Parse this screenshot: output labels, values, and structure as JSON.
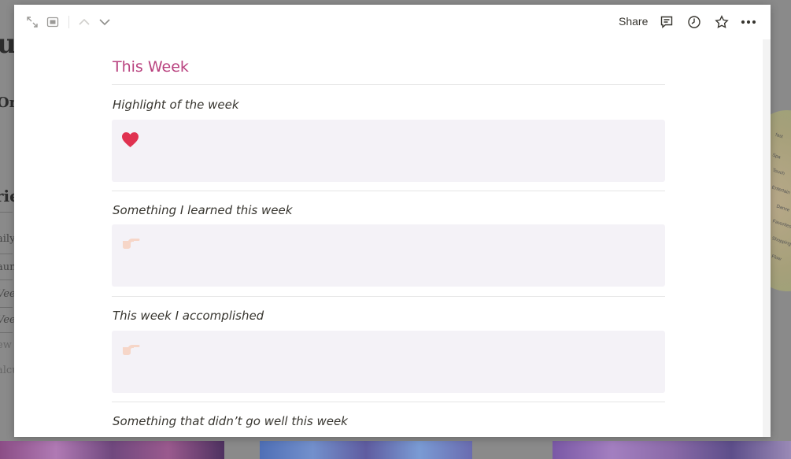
{
  "background_page": {
    "text_fragments": [
      {
        "text": "u",
        "class": "bg-big",
        "top": null
      },
      {
        "text": "On",
        "class": "bg-on",
        "top": null
      },
      {
        "text": "rie",
        "class": "bg-rie",
        "top": null
      }
    ],
    "sidebar_items": [
      "aily",
      "aun",
      "Vee",
      "Vee",
      "ew",
      "alcu"
    ],
    "wheel_labels": [
      "fast",
      "Spa",
      "Touch",
      "Entertain",
      "Dance",
      "Favorites",
      "Shopping",
      "Flow"
    ]
  },
  "topbar": {
    "expand_icon": "expand-icon",
    "peek_mode_icon": "peek-mode-icon",
    "prev_icon": "chevron-up-icon",
    "next_icon": "chevron-down-icon",
    "share_label": "Share",
    "comment_icon": "comment-icon",
    "history_icon": "clock-icon",
    "favorite_icon": "star-icon",
    "more_icon": "more-icon"
  },
  "page": {
    "title": "This Week",
    "title_color": "#b9427f",
    "sections": [
      {
        "heading": "Highlight of the week",
        "icon": "heart-icon",
        "icon_color": "#e03250"
      },
      {
        "heading": "Something I learned this week",
        "icon": "pointing-hand-icon",
        "icon_color": "#f6d6c8"
      },
      {
        "heading": "This week I accomplished",
        "icon": "pointing-hand-icon",
        "icon_color": "#f6d6c8"
      },
      {
        "heading": "Something that didn’t go well this week"
      }
    ]
  }
}
